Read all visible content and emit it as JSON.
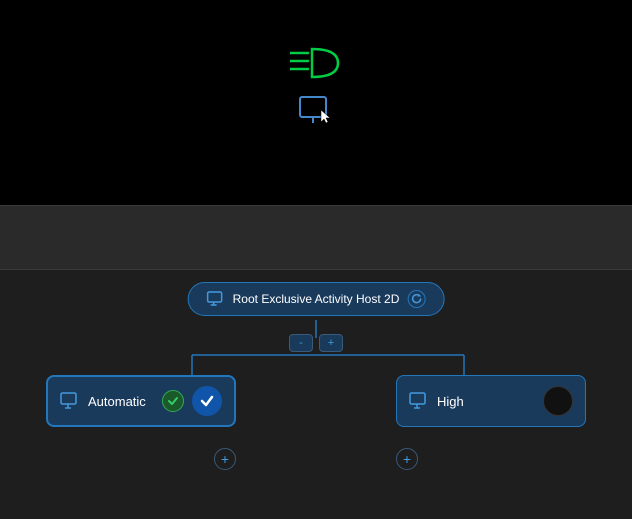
{
  "canvas": {
    "background": "#000000"
  },
  "root_node": {
    "label": "Root Exclusive Activity Host 2D",
    "icon": "monitor-icon",
    "refresh_icon": "refresh-icon"
  },
  "toggle_buttons": {
    "collapse_label": "-",
    "expand_label": "+"
  },
  "automatic_node": {
    "label": "Automatic",
    "icon": "monitor-icon",
    "check_label": "✓",
    "confirm_label": "✓"
  },
  "high_node": {
    "label": "High",
    "icon": "monitor-icon"
  },
  "add_buttons": {
    "left_label": "+",
    "right_label": "+"
  },
  "colors": {
    "node_bg": "#1a3a5c",
    "node_border": "#2277bb",
    "accent": "#4499dd",
    "green_check": "#33cc66",
    "black_circle": "#111111"
  }
}
